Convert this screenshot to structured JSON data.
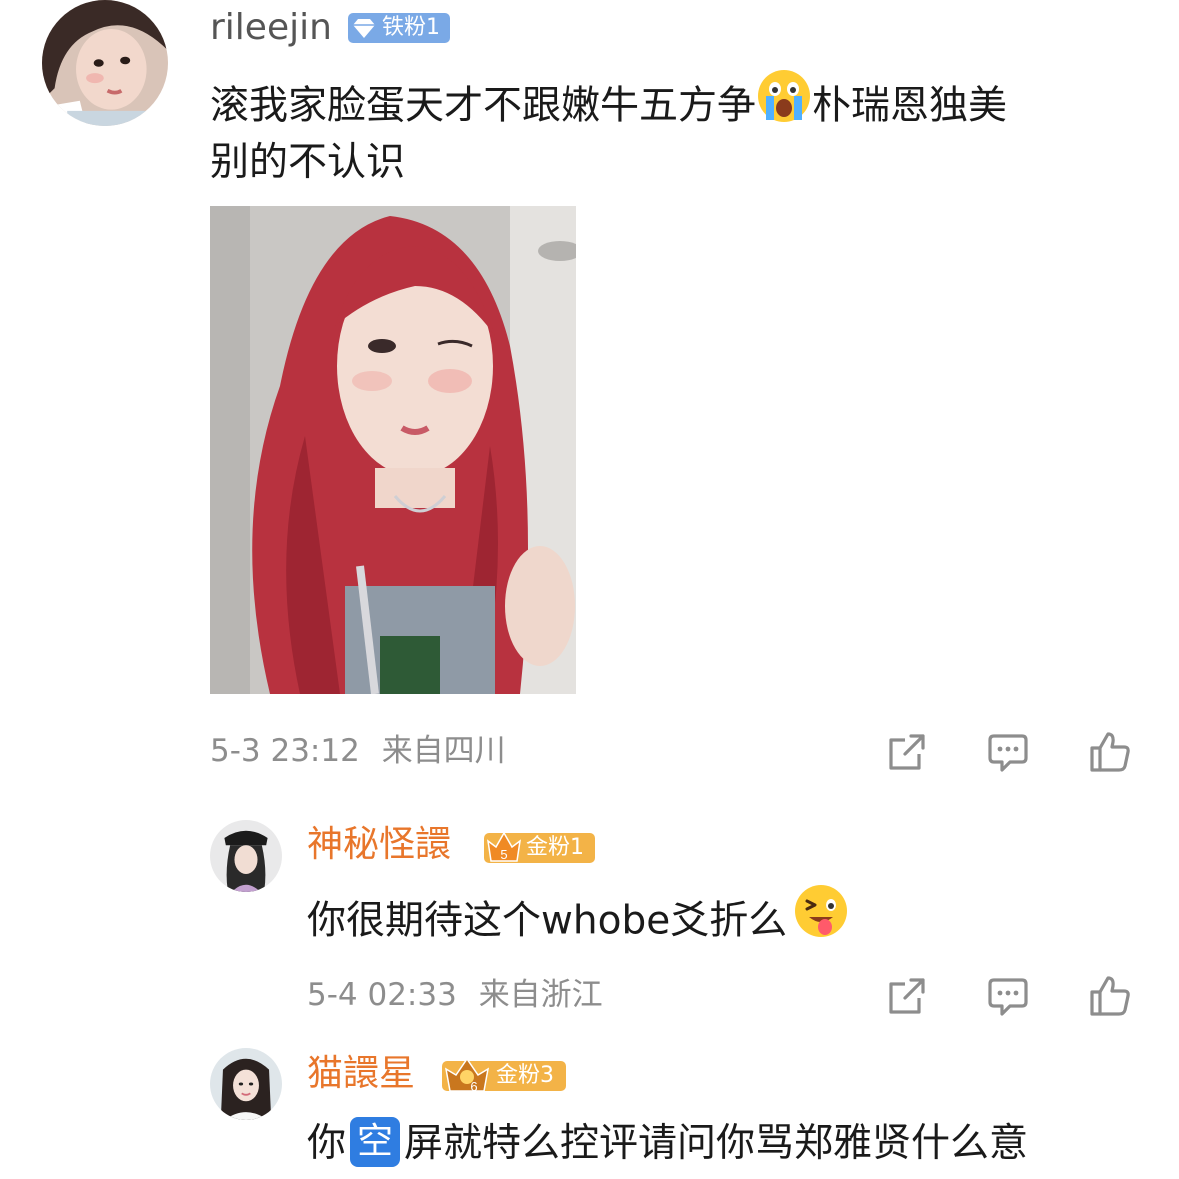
{
  "comments": [
    {
      "username": "rileejin",
      "badge": "铁粉1",
      "text_line1_a": "滚我家脸蛋天才不跟嫩牛五方争",
      "emoji1": "crying-face-emoji",
      "text_line1_b": "朴瑞恩独美",
      "text_line2": "别的不认识",
      "time": "5-3 23:12",
      "location": "来自四川"
    },
    {
      "username": "神秘怪譞",
      "badge": "金粉1",
      "badge_level": "5",
      "text": "你很期待这个whobe爻折么",
      "emoji": "winking-tongue-emoji",
      "time": "5-4 02:33",
      "location": "来自浙江"
    },
    {
      "username": "猫譞星",
      "badge": "金粉3",
      "badge_level": "6",
      "text_a": "你",
      "highlight": "空",
      "text_b": "屏就特么控评请问你骂郑雅贤什么意"
    }
  ],
  "icons": {
    "share": "share-icon",
    "comment": "comment-icon",
    "like": "like-icon"
  },
  "colors": {
    "username_primary": "#555555",
    "username_gold": "#e8762b",
    "meta": "#8d8d8d",
    "badge_iron": "#7aa9e6",
    "badge_gold": "#f0a93a",
    "kong": "#2f7de1"
  }
}
